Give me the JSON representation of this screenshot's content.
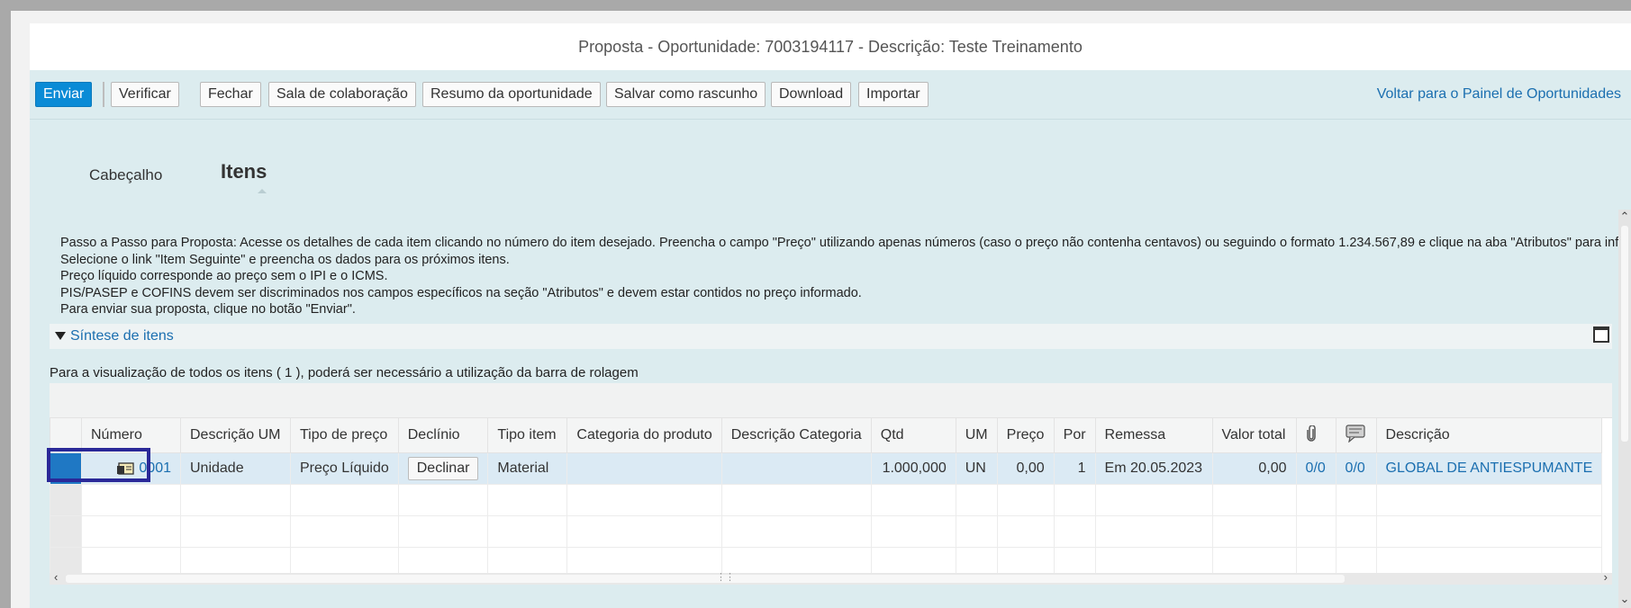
{
  "title": "Proposta - Oportunidade: 7003194117 - Descrição: Teste Treinamento",
  "toolbar": {
    "send": "Enviar",
    "verify": "Verificar",
    "close": "Fechar",
    "collab_room": "Sala de colaboração",
    "opp_summary": "Resumo da oportunidade",
    "save_draft": "Salvar como rascunho",
    "download": "Download",
    "import": "Importar",
    "back_link": "Voltar para o Painel de Oportunidades"
  },
  "tabs": {
    "header": "Cabeçalho",
    "items": "Itens"
  },
  "instructions": [
    "Passo a Passo para Proposta: Acesse os detalhes de cada item clicando no número do item desejado. Preencha o campo \"Preço\" utilizando apenas números (caso o preço não contenha centavos) ou seguindo o formato 1.234.567,89 e clique na aba \"Atributos\" para informar o PIS/PASEP e COFINS.",
    "Selecione o link \"Item Seguinte\" e preencha os dados para os próximos itens.",
    "Preço líquido corresponde ao preço sem o IPI e o ICMS.",
    "PIS/PASEP e COFINS devem ser discriminados nos campos específicos na seção \"Atributos\" e devem estar contidos no preço informado.",
    "Para enviar sua proposta, clique no botão \"Enviar\"."
  ],
  "summary": {
    "title": "Síntese de itens",
    "note": "Para a visualização de todos os itens ( 1 ), poderá ser necessário a utilização da barra de rolagem"
  },
  "table": {
    "headers": {
      "numero": "Número",
      "desc_um": "Descrição UM",
      "tipo_preco": "Tipo de preço",
      "declinio": "Declínio",
      "tipo_item": "Tipo item",
      "categoria": "Categoria do produto",
      "desc_categoria": "Descrição Categoria",
      "qtd": "Qtd",
      "um": "UM",
      "preco": "Preço",
      "por": "Por",
      "remessa": "Remessa",
      "valor_total": "Valor total",
      "descricao": "Descrição"
    },
    "row": {
      "numero": "0001",
      "desc_um": "Unidade",
      "tipo_preco": "Preço Líquido",
      "declinio": "Declinar",
      "tipo_item": "Material",
      "categoria": "",
      "desc_categoria": "",
      "qtd": "1.000,000",
      "um": "UN",
      "preco": "0,00",
      "por": "1",
      "remessa": "Em 20.05.2023",
      "valor_total": "0,00",
      "anexos": "0/0",
      "comentarios": "0/0",
      "descricao": "GLOBAL DE ANTIESPUMANTE"
    }
  },
  "colors": {
    "primary": "#0a8bd6",
    "link": "#1b6fb0",
    "background": "#dcecef",
    "selected_row": "#dbeaf4"
  }
}
